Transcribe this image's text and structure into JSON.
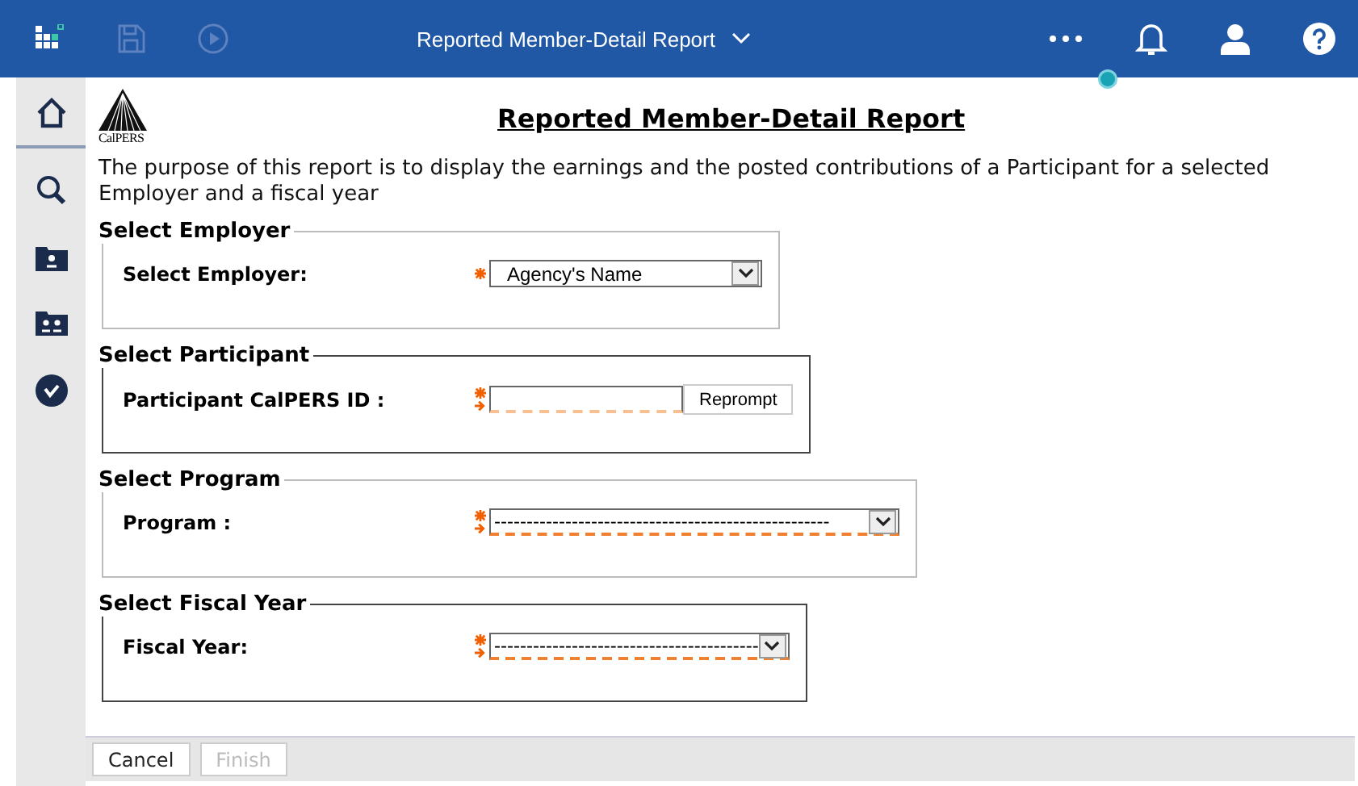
{
  "topbar": {
    "title": "Reported Member-Detail Report"
  },
  "logo": {
    "text": "CalPERS"
  },
  "report": {
    "title": "Reported Member-Detail Report",
    "description": "The purpose of this report is to display the earnings and the posted contributions of a Participant for a selected Employer and a fiscal year"
  },
  "sections": [
    {
      "legend": "Select Employer",
      "label": "Select Employer:",
      "kind": "select",
      "value": "Agency's Name",
      "invalid": false,
      "highlighted": false
    },
    {
      "legend": "Select Participant",
      "label": "Participant CalPERS ID :",
      "kind": "text",
      "button": "Reprompt",
      "invalid": true,
      "highlighted": true
    },
    {
      "legend": "Select Program",
      "label": "Program :",
      "kind": "select",
      "value": "----------------------------------------------------",
      "invalid": true,
      "highlighted": false
    },
    {
      "legend": "Select Fiscal Year",
      "label": "Fiscal Year:",
      "kind": "select",
      "value": "-----------------------------------------",
      "invalid": true,
      "highlighted": true
    }
  ],
  "buttons": [
    {
      "label": "Cancel",
      "disabled": false
    },
    {
      "label": "Finish",
      "disabled": true
    }
  ]
}
